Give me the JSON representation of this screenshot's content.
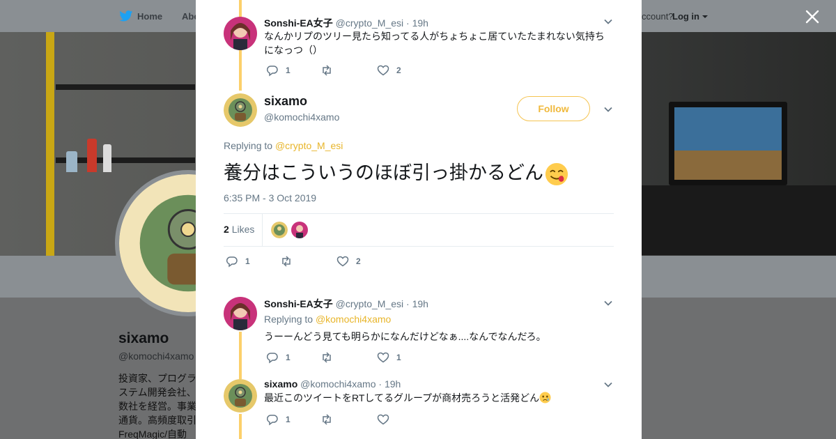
{
  "topbar": {
    "home_label": "Home",
    "about_label": "Abo",
    "account_question": "ccount?",
    "login_label": "Log in"
  },
  "profile": {
    "name": "sixamo",
    "handle": "@komochi4xamo",
    "bio": "投資家、プログラ\nステム開発会社、\n数社を経営。事業\n通貨。高頻度取引\nFreqMagic/自動売"
  },
  "colors": {
    "accent": "#f0b93c",
    "thread_line": "#fcd06b",
    "muted": "#657786",
    "text": "#14171a"
  },
  "tweets": {
    "reply_top": {
      "name": "Sonshi-EA女子",
      "handle": "@crypto_M_esi",
      "time": "· 19h",
      "text": "なんかリプのツリー見たら知ってる人がちょちょこ居ていたたまれない気持ちになっつ（）",
      "reply_count": "1",
      "retweet_count": "",
      "like_count": "2"
    },
    "main": {
      "name": "sixamo",
      "handle": "@komochi4xamo",
      "follow_label": "Follow",
      "replying_prefix": "Replying to ",
      "replying_to": "@crypto_M_esi",
      "text": "養分はこういうのほぼ引っ掛かるどん",
      "emoji": "face-savoring-food-emoji",
      "timestamp": "6:35 PM - 3 Oct 2019",
      "likes_number": "2",
      "likes_label": "Likes",
      "reply_count": "1",
      "retweet_count": "",
      "like_count": "2"
    },
    "reply_2": {
      "name": "Sonshi-EA女子",
      "handle": "@crypto_M_esi",
      "time": "· 19h",
      "replying_prefix": "Replying to ",
      "replying_to": "@komochi4xamo",
      "text": "うーーんどう見ても明らかになんだけどなぁ....なんでなんだろ。",
      "reply_count": "1",
      "retweet_count": "",
      "like_count": "1"
    },
    "reply_3": {
      "name": "sixamo",
      "handle": "@komochi4xamo",
      "time": "· 19h",
      "text": "最近このツイートをRTしてるグループが商材売ろうと活発どん",
      "emoji": "crying-face-emoji",
      "reply_count": "1",
      "retweet_count": "",
      "like_count": ""
    }
  }
}
